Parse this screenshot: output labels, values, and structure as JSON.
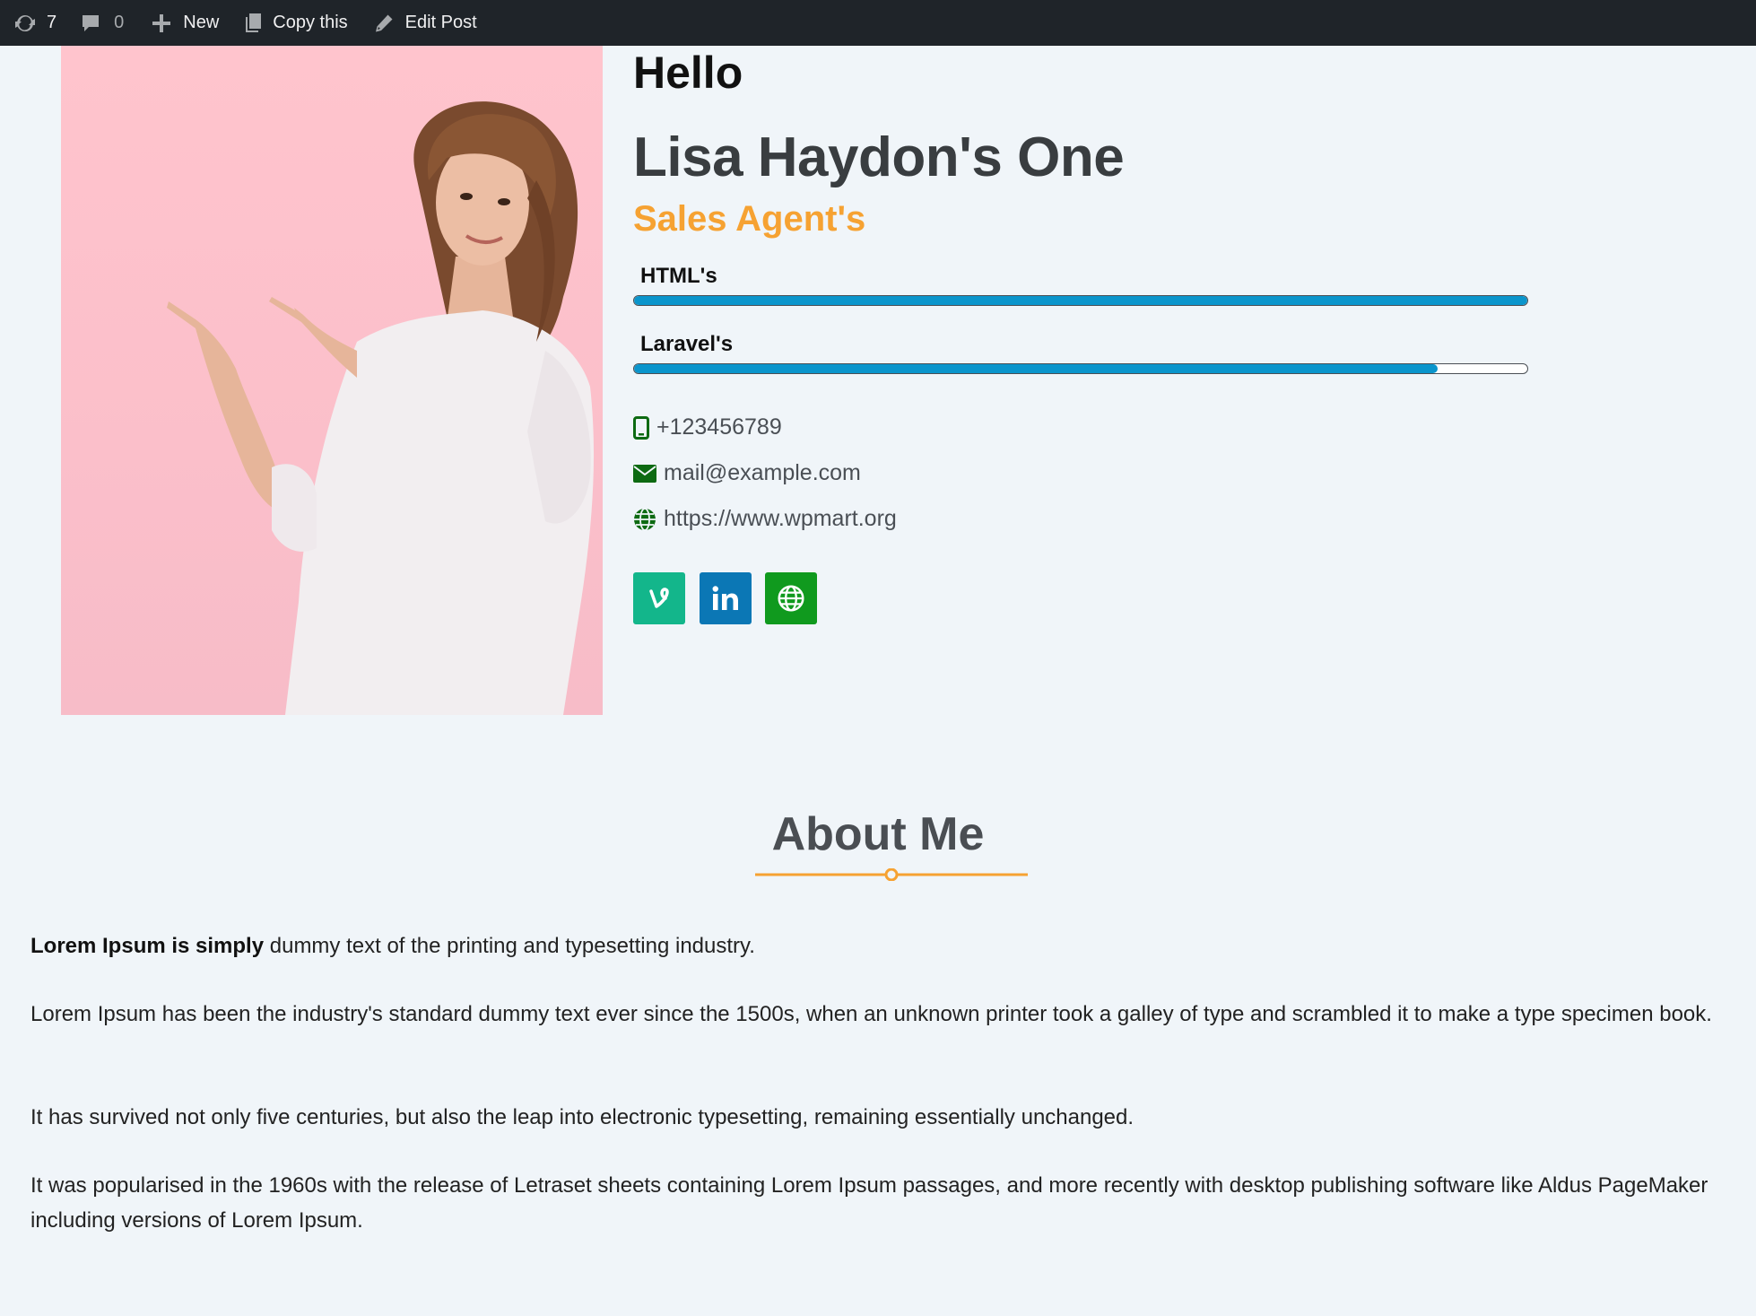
{
  "adminbar": {
    "updates_count": "7",
    "comments_count": "0",
    "new_label": "New",
    "copy_label": "Copy this",
    "edit_label": "Edit Post"
  },
  "profile": {
    "greeting": "Hello",
    "name": "Lisa Haydon's One",
    "role": "Sales Agent's",
    "skills": [
      {
        "label": "HTML's",
        "percent": 100
      },
      {
        "label": "Laravel's",
        "percent": 90
      }
    ],
    "contacts": {
      "phone": "+123456789",
      "email": "mail@example.com",
      "website": "https://www.wpmart.org"
    },
    "social": [
      {
        "icon": "vine-icon",
        "color": "#13b68b"
      },
      {
        "icon": "linkedin-icon",
        "color": "#0b77b5"
      },
      {
        "icon": "globe-icon",
        "color": "#109a1e"
      }
    ]
  },
  "about": {
    "title": "About Me",
    "accent_color": "#f6a232",
    "p1_bold": "Lorem Ipsum is simply",
    "p1_rest": " dummy text of the printing and typesetting industry.",
    "p2": "Lorem Ipsum has been the industry's standard dummy text ever since the 1500s, when an unknown printer took a galley of type and scrambled it to make a type specimen book.",
    "p3": "It has survived not only five centuries, but also the leap into electronic typesetting, remaining essentially unchanged.",
    "p4": "It was popularised in the 1960s with the release of Letraset sheets containing Lorem Ipsum passages, and more recently with desktop publishing software like Aldus PageMaker including versions of Lorem Ipsum."
  }
}
